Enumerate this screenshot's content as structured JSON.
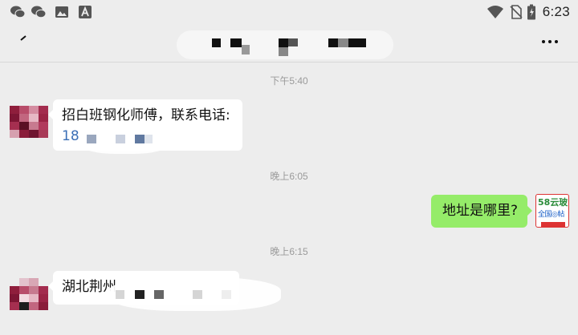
{
  "status_bar": {
    "time": "6:23",
    "left_icons": [
      "wechat-icon",
      "wechat-icon",
      "image-icon",
      "text-a-icon"
    ],
    "right_icons": [
      "wifi-icon",
      "no-sim-icon",
      "battery-icon"
    ]
  },
  "header": {
    "title_obscured": true,
    "back_icon": "back-arrow-icon",
    "more_icon": "more-dots-icon"
  },
  "messages": [
    {
      "type": "timestamp",
      "text": "下午5:40"
    },
    {
      "type": "incoming",
      "line1": "招白班钢化师傅，联系电话:",
      "line2": "18"
    },
    {
      "type": "timestamp",
      "text": "晚上6:05"
    },
    {
      "type": "outgoing",
      "text": "地址是哪里?"
    },
    {
      "type": "timestamp",
      "text": "晚上6:15"
    },
    {
      "type": "incoming",
      "line1": "湖北荆州"
    }
  ],
  "self_avatar": {
    "line1": "58云玻",
    "line2": "全国◎帖"
  },
  "colors": {
    "background": "#ededed",
    "outgoing_bubble": "#95ec69",
    "incoming_bubble": "#ffffff",
    "phone_link": "#3b6fb6"
  }
}
